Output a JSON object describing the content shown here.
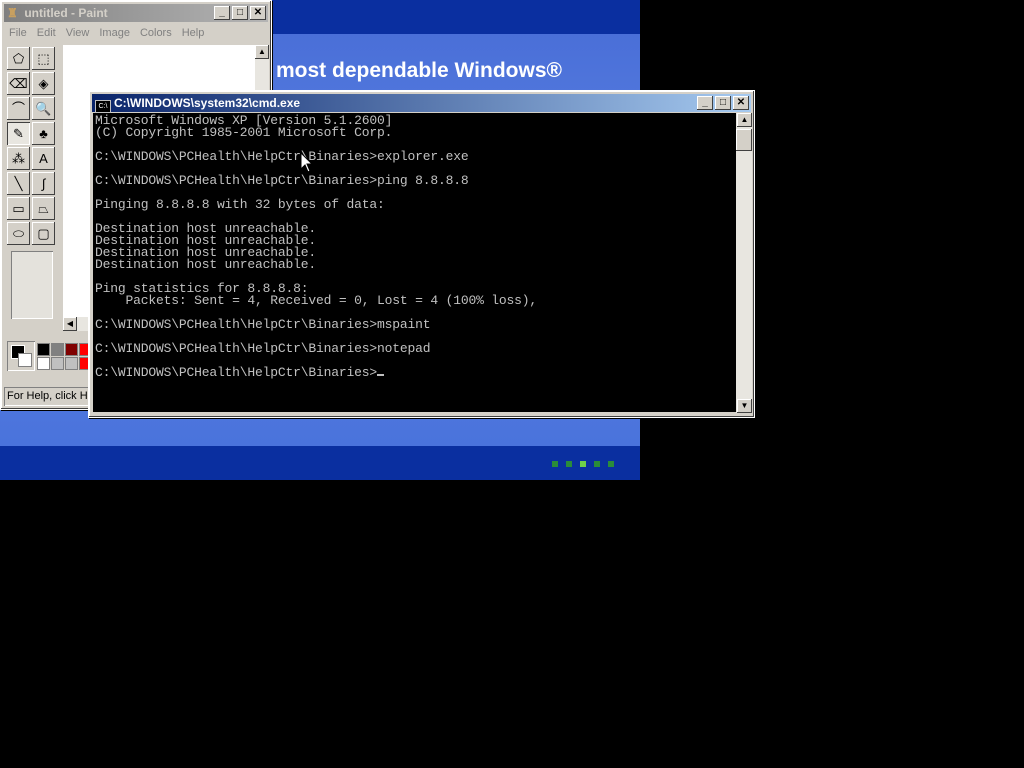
{
  "setup_screen": {
    "headline": "most dependable Windows®"
  },
  "paint": {
    "title": "untitled - Paint",
    "menu": [
      "File",
      "Edit",
      "View",
      "Image",
      "Colors",
      "Help"
    ],
    "status": "For Help, click Help Topics on the Help Menu.",
    "tools": [
      {
        "name": "free-form-select-icon",
        "glyph": "⬠"
      },
      {
        "name": "select-icon",
        "glyph": "⬚"
      },
      {
        "name": "eraser-icon",
        "glyph": "⌫"
      },
      {
        "name": "fill-icon",
        "glyph": "◈"
      },
      {
        "name": "pick-color-icon",
        "glyph": "⌒"
      },
      {
        "name": "magnifier-icon",
        "glyph": "🔍"
      },
      {
        "name": "pencil-icon",
        "glyph": "✎"
      },
      {
        "name": "brush-icon",
        "glyph": "♣"
      },
      {
        "name": "airbrush-icon",
        "glyph": "⁂"
      },
      {
        "name": "text-icon",
        "glyph": "A"
      },
      {
        "name": "line-icon",
        "glyph": "╲"
      },
      {
        "name": "curve-icon",
        "glyph": "∫"
      },
      {
        "name": "rectangle-icon",
        "glyph": "▭"
      },
      {
        "name": "polygon-icon",
        "glyph": "⏢"
      },
      {
        "name": "ellipse-icon",
        "glyph": "⬭"
      },
      {
        "name": "rounded-rectangle-icon",
        "glyph": "▢"
      }
    ],
    "palette_colors": [
      "#000000",
      "#808080",
      "#800000",
      "#ff0000",
      "#ffffff",
      "#c0c0c0",
      "#c0c0c0",
      "#ff0000"
    ]
  },
  "cmd": {
    "title": "C:\\WINDOWS\\system32\\cmd.exe",
    "lines": [
      "Microsoft Windows XP [Version 5.1.2600]",
      "(C) Copyright 1985-2001 Microsoft Corp.",
      "",
      "C:\\WINDOWS\\PCHealth\\HelpCtr\\Binaries>explorer.exe",
      "",
      "C:\\WINDOWS\\PCHealth\\HelpCtr\\Binaries>ping 8.8.8.8",
      "",
      "Pinging 8.8.8.8 with 32 bytes of data:",
      "",
      "Destination host unreachable.",
      "Destination host unreachable.",
      "Destination host unreachable.",
      "Destination host unreachable.",
      "",
      "Ping statistics for 8.8.8.8:",
      "    Packets: Sent = 4, Received = 0, Lost = 4 (100% loss),",
      "",
      "C:\\WINDOWS\\PCHealth\\HelpCtr\\Binaries>mspaint",
      "",
      "C:\\WINDOWS\\PCHealth\\HelpCtr\\Binaries>notepad",
      "",
      "C:\\WINDOWS\\PCHealth\\HelpCtr\\Binaries>"
    ]
  },
  "colors": {
    "console_text": "#c0c0c0",
    "active_caption": "#0a246a",
    "setup_blue": "#5a7edc"
  }
}
